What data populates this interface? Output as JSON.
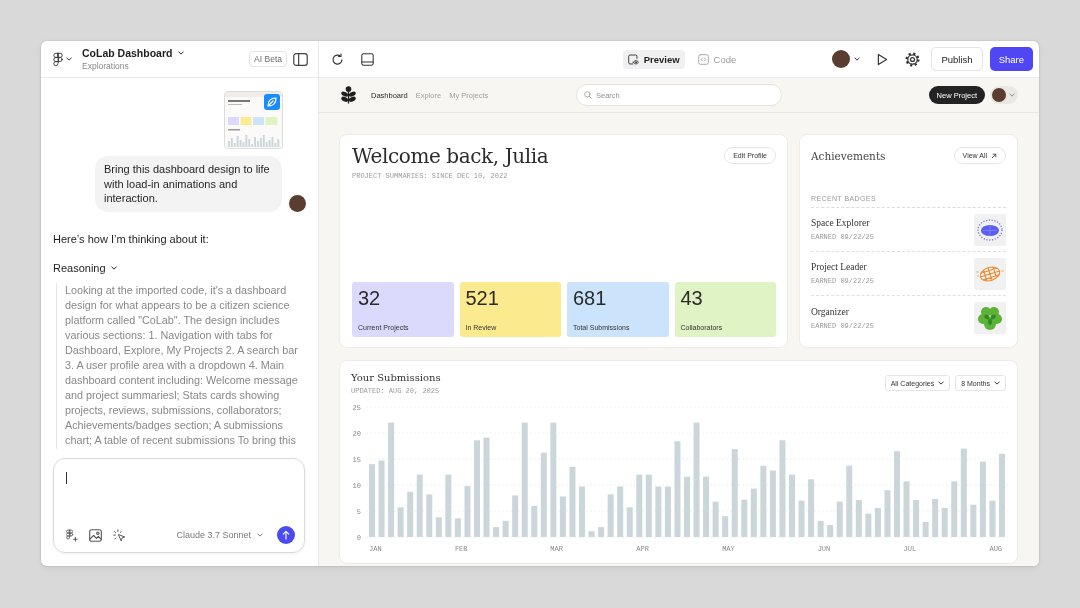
{
  "app_header": {
    "title": "CoLab Dashboard",
    "subtitle": "Explorations",
    "badge": "AI Beta"
  },
  "toolbar": {
    "view_tabs": [
      {
        "label": "Preview",
        "selected": true
      },
      {
        "label": "Code",
        "selected": false
      }
    ],
    "publish_button": "Publish",
    "share_button": "Share"
  },
  "chat": {
    "user_message": "Bring this dashboard design to life with load-in animations and interaction.",
    "assistant_intro": "Here’s how I’m thinking about it:",
    "reasoning": {
      "label": "Reasoning",
      "expanded": true,
      "text": "Looking at the imported code, it's a dashboard design for what appears to be a citizen science platform called \"CoLab\". The design includes various sections: 1. Navigation with tabs for Dashboard, Explore, My Projects 2. A search bar 3. A user profile area with a dropdown 4. Main dashboard content including: Welcome message and project summariesl; Stats cards showing projects, reviews, submissions, collaborators; Achievements/badges section; A submissions chart; A table of recent submissions To bring this"
    },
    "composer": {
      "model": "Claude 3.7 Sonnet"
    }
  },
  "preview": {
    "nav": {
      "links": [
        {
          "label": "Dashboard",
          "selected": true
        },
        {
          "label": "Explore",
          "selected": false
        },
        {
          "label": "My Projects",
          "selected": false
        }
      ],
      "search": {
        "placeholder": "Search"
      },
      "new_project_button": "New Project"
    },
    "welcome": {
      "title": "Welcome back, Julia",
      "caption": "PROJECT SUMMARIES: SINCE DEC 10, 2022",
      "edit_button": "Edit Profile",
      "stats": [
        {
          "value": "32",
          "label": "Current Projects",
          "color": "#dcdafc"
        },
        {
          "value": "521",
          "label": "In Review",
          "color": "#fceb8e"
        },
        {
          "value": "681",
          "label": "Total Submissions",
          "color": "#cce3fc"
        },
        {
          "value": "43",
          "label": "Collaborators",
          "color": "#e0f3c4"
        }
      ]
    },
    "achievements": {
      "title": "Achievements",
      "view_all_button": "View All",
      "section_label": "RECENT BADGES",
      "badges": [
        {
          "name": "Space Explorer",
          "earned": "EARNED 09/22/25",
          "kind": "planet"
        },
        {
          "name": "Project Leader",
          "earned": "EARNED 09/22/25",
          "kind": "globe"
        },
        {
          "name": "Organizer",
          "earned": "EARNED 09/22/25",
          "kind": "leaf"
        }
      ]
    },
    "submissions": {
      "title": "Your Submissions",
      "updated": "UPDATED: AUG 20, 2025",
      "filters": [
        "All Categories",
        "8 Months"
      ],
      "chart_data": {
        "type": "bar",
        "categories": [
          "JAN",
          null,
          null,
          null,
          null,
          null,
          null,
          null,
          null,
          "FEB",
          null,
          null,
          null,
          null,
          null,
          null,
          null,
          null,
          null,
          "MAR",
          null,
          null,
          null,
          null,
          null,
          null,
          null,
          null,
          "APR",
          null,
          null,
          null,
          null,
          null,
          null,
          null,
          null,
          "MAY",
          null,
          null,
          null,
          null,
          null,
          null,
          null,
          null,
          null,
          "JUN",
          null,
          null,
          null,
          null,
          null,
          null,
          null,
          null,
          "JUL",
          null,
          null,
          null,
          null,
          null,
          null,
          null,
          null,
          "AUG",
          null
        ],
        "values": [
          14,
          14.7,
          22,
          5.7,
          8.7,
          12,
          8.2,
          3.8,
          12,
          3.6,
          9.8,
          18.6,
          19.1,
          1.9,
          3.1,
          8,
          22,
          6,
          16.2,
          22,
          7.8,
          13.5,
          9.7,
          1.1,
          1.9,
          8.2,
          9.7,
          5.7,
          12,
          12,
          9.7,
          9.7,
          18.4,
          11.6,
          22,
          11.6,
          6.8,
          4,
          16.9,
          7.2,
          9.3,
          13.7,
          12.8,
          18.6,
          12,
          7,
          11.1,
          3.1,
          2.3,
          6.8,
          13.7,
          7.1,
          4.5,
          5.6,
          9,
          16.5,
          10.7,
          7.1,
          2.9,
          7.3,
          5.6,
          10.7,
          17,
          6.2,
          14.5,
          7,
          16
        ],
        "ylim": [
          0,
          25
        ],
        "yticks": [
          0,
          5,
          10,
          15,
          20,
          25
        ],
        "grid": true
      }
    }
  }
}
